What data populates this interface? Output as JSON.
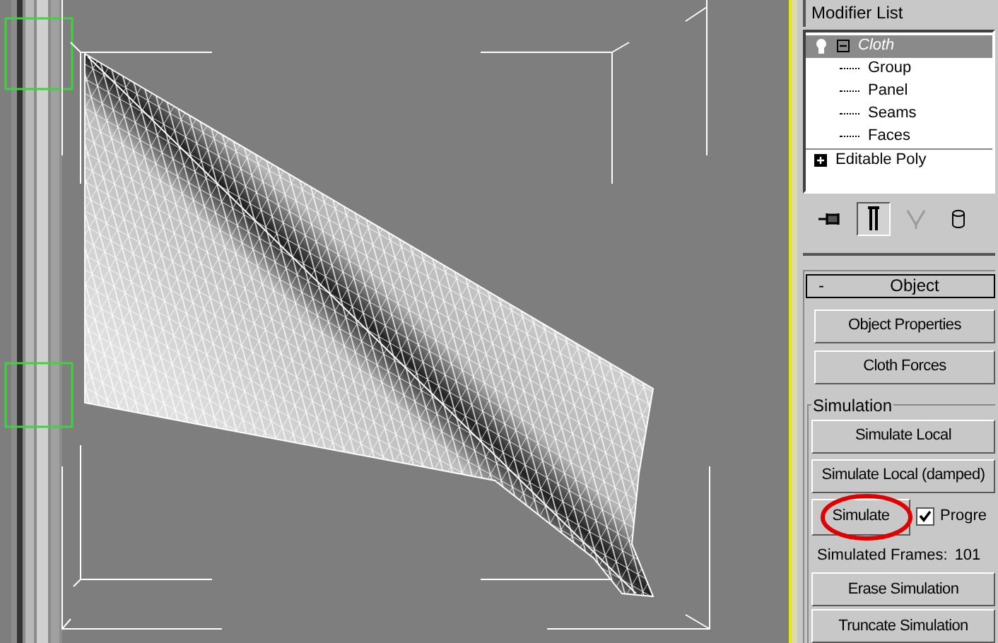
{
  "modifier_list": {
    "label": "Modifier List"
  },
  "stack": [
    {
      "label": "Cloth",
      "selected": true,
      "expanded": true,
      "children": [
        {
          "label": "Group"
        },
        {
          "label": "Panel"
        },
        {
          "label": "Seams"
        },
        {
          "label": "Faces"
        }
      ]
    },
    {
      "label": "Editable Poly",
      "selected": false,
      "expanded": false
    }
  ],
  "stack_toolbar": [
    {
      "pressed": false
    },
    {
      "pressed": true
    },
    {
      "pressed": false
    },
    {
      "pressed": false
    }
  ],
  "rollout": {
    "title": "Object",
    "toggle": "-",
    "expanded": true,
    "buttons": [
      "Object Properties",
      "Cloth Forces"
    ],
    "simulation": {
      "label": "Simulation",
      "buttons": [
        "Simulate Local",
        "Simulate Local (damped)"
      ],
      "simulate_button": "Simulate",
      "progress_checkbox": {
        "label": "Progre",
        "checked": true
      },
      "frames_label": "Simulated Frames:",
      "frames_value": "101",
      "bottom_buttons": [
        "Erase Simulation",
        "Truncate Simulation"
      ]
    }
  }
}
